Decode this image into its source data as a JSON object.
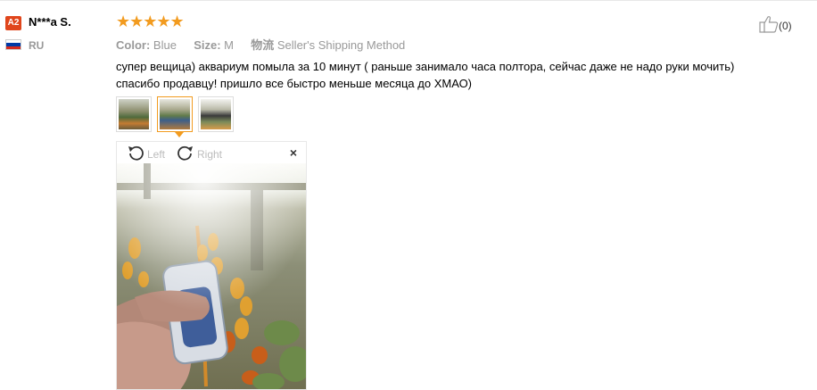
{
  "user": {
    "badge": "A2",
    "name": "N***a S.",
    "country": "RU",
    "flag_colors": [
      "#ffffff",
      "#0039a6",
      "#d52b1e"
    ]
  },
  "rating": {
    "stars": "★★★★★",
    "value": 5,
    "color": "#f29b1f"
  },
  "attributes": {
    "color_label": "Color:",
    "color_value": "Blue",
    "size_label": "Size:",
    "size_value": "M",
    "shipping_label": "物流",
    "shipping_value": "Seller's Shipping Method"
  },
  "review_text": "супер вещица) аквариум помыла за 10 минут ( раньше занимало часа полтора, сейчас даже не надо руки мочить) спасибо продавцу! пришло все быстро меньше месяца до ХМАО)",
  "helpful": {
    "count": "(0)",
    "icon": "thumbs-up-icon"
  },
  "thumbnails": [
    {
      "name": "thumbnail-1",
      "active": false
    },
    {
      "name": "thumbnail-2",
      "active": true
    },
    {
      "name": "thumbnail-3",
      "active": false
    }
  ],
  "viewer": {
    "rotate_left": "Left",
    "rotate_right": "Right",
    "close": "×"
  }
}
